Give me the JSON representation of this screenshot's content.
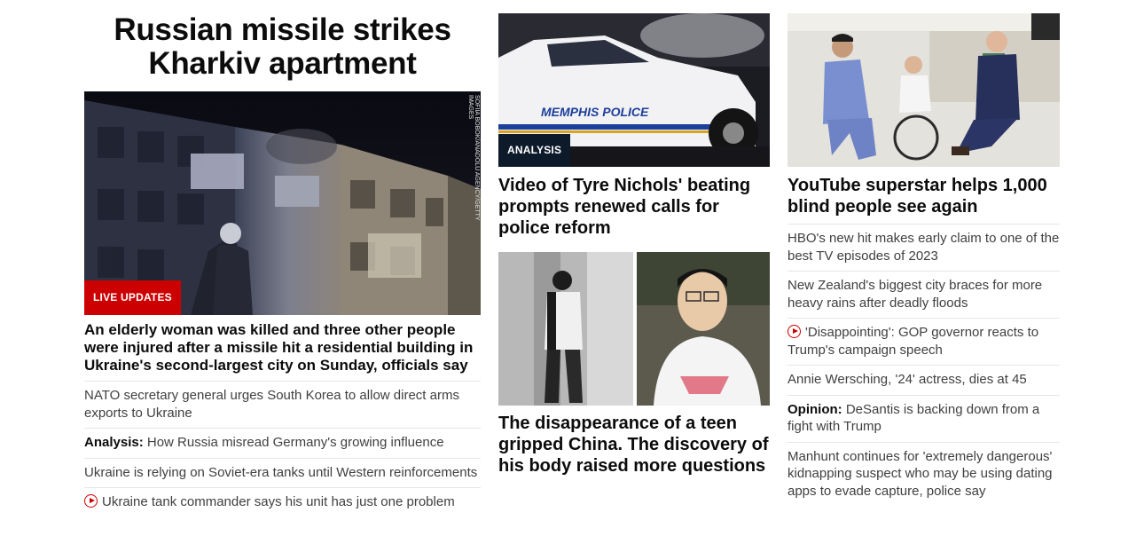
{
  "main_story": {
    "headline": "Russian missile strikes Kharkiv apartment",
    "image_credit": "SOFIIA BOBOK/ANADOLU AGENCY/GETTY IMAGES",
    "badge": "LIVE UPDATES",
    "summary": "An elderly woman was killed and three other people were injured after a missile hit a residential building in Ukraine's second-largest city on Sunday, officials say",
    "related": [
      {
        "prefix": "",
        "text": "NATO secretary general urges South Korea to allow direct arms exports to Ukraine",
        "video": false
      },
      {
        "prefix": "Analysis:",
        "text": " How Russia misread Germany's growing influence",
        "video": false
      },
      {
        "prefix": "",
        "text": "Ukraine is relying on Soviet-era tanks until Western reinforcements",
        "video": false
      },
      {
        "prefix": "",
        "text": "Ukraine tank commander says his unit has just one problem",
        "video": true
      }
    ]
  },
  "middle": {
    "card1": {
      "badge": "ANALYSIS",
      "car_text": "MEMPHIS POLICE",
      "title": "Video of Tyre Nichols' beating prompts renewed calls for police reform"
    },
    "card2": {
      "title": "The disappearance of a teen gripped China. The discovery of his body raised more questions"
    }
  },
  "right": {
    "card": {
      "title": "YouTube superstar helps 1,000 blind people see again"
    },
    "links": [
      {
        "prefix": "",
        "text": "HBO's new hit makes early claim to one of the best TV episodes of 2023",
        "video": false
      },
      {
        "prefix": "",
        "text": "New Zealand's biggest city braces for more heavy rains after deadly floods",
        "video": false
      },
      {
        "prefix": "",
        "text": "'Disappointing': GOP governor reacts to Trump's campaign speech",
        "video": true
      },
      {
        "prefix": "",
        "text": "Annie Wersching, '24' actress, dies at 45",
        "video": false
      },
      {
        "prefix": "Opinion:",
        "text": " DeSantis is backing down from a fight with Trump",
        "video": false
      },
      {
        "prefix": "",
        "text": "Manhunt continues for 'extremely dangerous' kidnapping suspect who may be using dating apps to evade capture, police say",
        "video": false
      }
    ]
  },
  "colors": {
    "live_red": "#cc0000",
    "analysis_navy": "#0c1a2a",
    "text": "#0c0c0c",
    "muted_text": "#404040",
    "divider": "#e6e6e6"
  }
}
